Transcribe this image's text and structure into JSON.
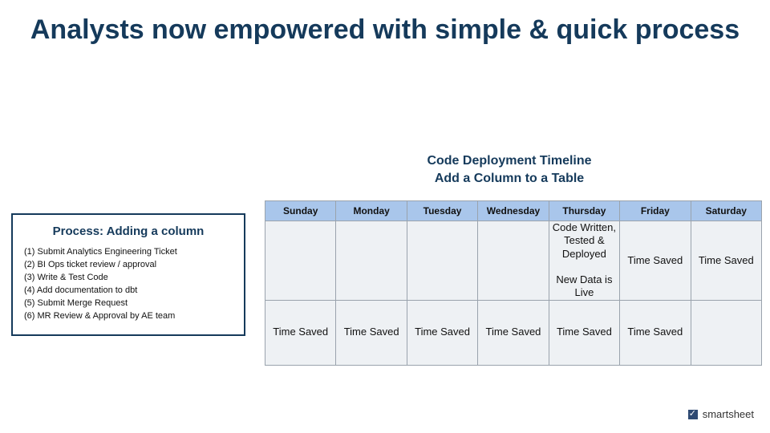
{
  "title": "Analysts now empowered with simple & quick process",
  "process": {
    "heading": "Process: Adding a column",
    "steps": [
      "(1) Submit Analytics Engineering Ticket",
      "(2) BI Ops ticket review / approval",
      "(3) Write & Test Code",
      "(4) Add documentation to dbt",
      "(5) Submit Merge Request",
      "(6) MR Review & Approval by AE team"
    ]
  },
  "timeline": {
    "heading_line1": "Code Deployment Timeline",
    "heading_line2": "Add a Column to a Table",
    "days": [
      "Sunday",
      "Monday",
      "Tuesday",
      "Wednesday",
      "Thursday",
      "Friday",
      "Saturday"
    ],
    "row1": {
      "sunday": "",
      "monday": "",
      "tuesday": "",
      "wednesday": "",
      "thursday_line1": "Code Written, Tested & Deployed",
      "thursday_line2": "New Data is Live",
      "friday": "Time Saved",
      "saturday": "Time Saved"
    },
    "row2": {
      "sunday": "Time Saved",
      "monday": "Time Saved",
      "tuesday": "Time Saved",
      "wednesday": "Time Saved",
      "thursday": "Time Saved",
      "friday": "Time Saved",
      "saturday": ""
    }
  },
  "brand": "smartsheet"
}
